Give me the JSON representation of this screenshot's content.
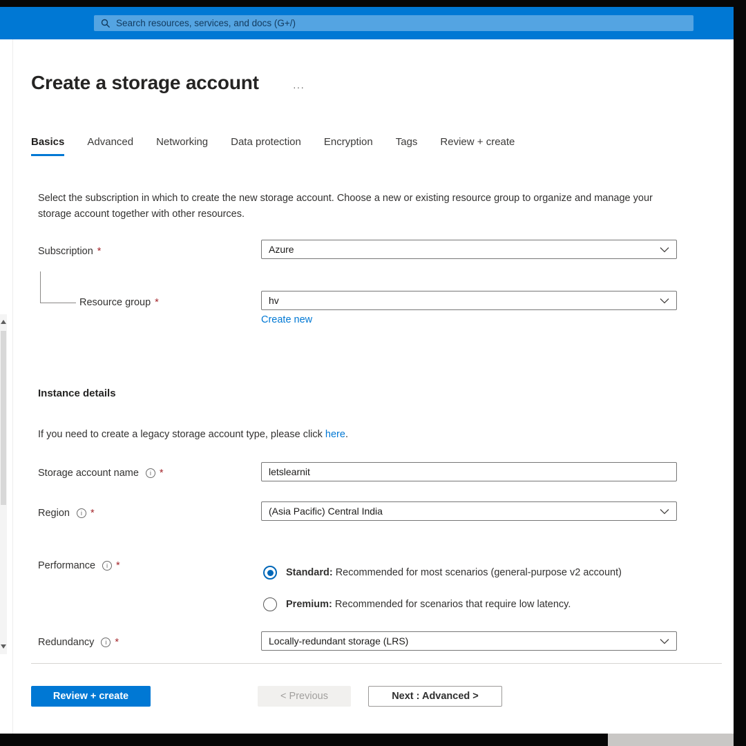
{
  "header": {
    "search_text": "Search resources, services, and docs (G+/)"
  },
  "page": {
    "title": "Create a storage account",
    "more_menu": "···"
  },
  "tabs": [
    {
      "label": "Basics",
      "active": true
    },
    {
      "label": "Advanced",
      "active": false
    },
    {
      "label": "Networking",
      "active": false
    },
    {
      "label": "Data protection",
      "active": false
    },
    {
      "label": "Encryption",
      "active": false
    },
    {
      "label": "Tags",
      "active": false
    },
    {
      "label": "Review + create",
      "active": false
    }
  ],
  "intro": "Select the subscription in which to create the new storage account. Choose a new or existing resource group to organize and manage your storage account together with other resources.",
  "required_marker": "*",
  "form": {
    "subscription": {
      "label": "Subscription",
      "value": "Azure"
    },
    "resource_group": {
      "label": "Resource group",
      "value": "hv",
      "create_new_link": "Create new"
    },
    "instance_details_heading": "Instance details",
    "legacy_note": {
      "prefix": "If you need to create a legacy storage account type, please click ",
      "link": "here",
      "suffix": "."
    },
    "storage_account_name": {
      "label": "Storage account name",
      "value": "letslearnit"
    },
    "region": {
      "label": "Region",
      "value": "(Asia Pacific) Central India"
    },
    "performance": {
      "label": "Performance",
      "options": [
        {
          "name": "Standard:",
          "description": " Recommended for most scenarios (general-purpose v2 account)",
          "selected": true
        },
        {
          "name": "Premium:",
          "description": " Recommended for scenarios that require low latency.",
          "selected": false
        }
      ]
    },
    "redundancy": {
      "label": "Redundancy",
      "value": "Locally-redundant storage (LRS)"
    }
  },
  "footer": {
    "review_create_button": "Review + create",
    "previous_button": "< Previous",
    "next_button": "Next : Advanced >"
  },
  "colors": {
    "accent": "#0078d4",
    "link": "#0078d4",
    "required": "#a4262c"
  }
}
